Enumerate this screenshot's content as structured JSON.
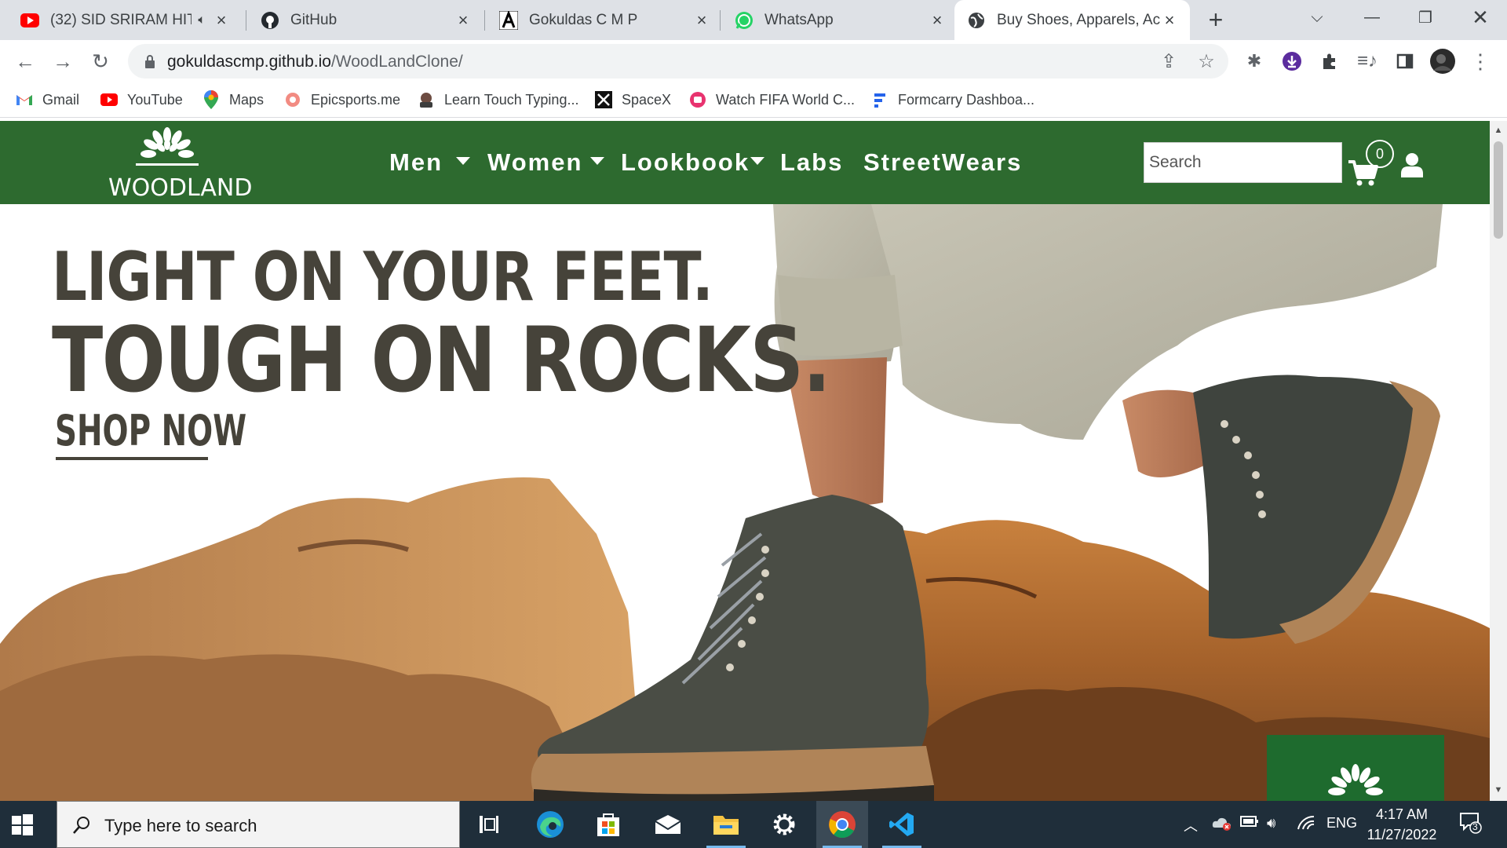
{
  "browser": {
    "tabs": [
      {
        "title": "(32) SID SRIRAM HIT",
        "favicon": "youtube-icon",
        "muted": true
      },
      {
        "title": "GitHub",
        "favicon": "github-icon"
      },
      {
        "title": "Gokuldas C M P",
        "favicon": "a-letter-icon"
      },
      {
        "title": "WhatsApp",
        "favicon": "whatsapp-icon"
      },
      {
        "title": "Buy Shoes, Apparels, Acce",
        "favicon": "globe-icon",
        "active": true
      }
    ],
    "url": {
      "host": "gokuldascmp.github.io",
      "path": "/WoodLandClone/"
    },
    "bookmarks": [
      {
        "label": "Gmail",
        "icon": "gmail-icon"
      },
      {
        "label": "YouTube",
        "icon": "youtube-icon"
      },
      {
        "label": "Maps",
        "icon": "maps-pin-icon"
      },
      {
        "label": "Epicsports.me",
        "icon": "epicsports-icon"
      },
      {
        "label": "Learn Touch Typing...",
        "icon": "typing-icon"
      },
      {
        "label": "SpaceX",
        "icon": "spacex-icon"
      },
      {
        "label": "Watch FIFA World C...",
        "icon": "fifa-icon"
      },
      {
        "label": "Formcarry Dashboa...",
        "icon": "formcarry-icon"
      }
    ]
  },
  "site": {
    "brand": "WOODLAND",
    "nav": [
      {
        "label": "Men",
        "dropdown": true
      },
      {
        "label": "Women",
        "dropdown": true
      },
      {
        "label": "Lookbook",
        "dropdown": true
      },
      {
        "label": "Labs",
        "dropdown": false
      },
      {
        "label": "StreetWears",
        "dropdown": false
      }
    ],
    "search_placeholder": "Search",
    "cart_count": "0",
    "colors": {
      "nav_bg": "#2d6a2f",
      "headline": "#46433a"
    }
  },
  "hero": {
    "line1": "LIGHT ON YOUR FEET.",
    "line2": "TOUGH ON ROCKS.",
    "cta": "SHOP NOW"
  },
  "taskbar": {
    "search_placeholder": "Type here to search",
    "language": "ENG",
    "time": "4:17 AM",
    "date": "11/27/2022",
    "notification_count": "3"
  }
}
